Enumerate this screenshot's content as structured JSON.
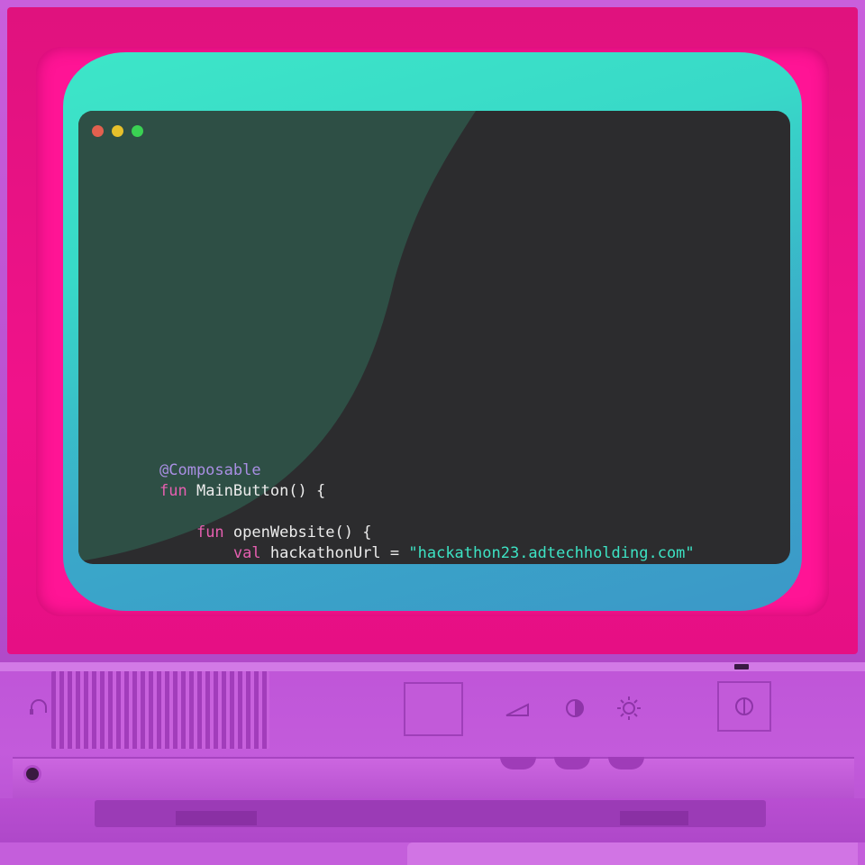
{
  "editor": {
    "window_controls": [
      "close",
      "minimize",
      "maximize"
    ],
    "colors": {
      "background": "#2c2c2e",
      "annotation": "#a98fe3",
      "keyword": "#e65fb0",
      "string": "#3de3c4",
      "text": "#ececec"
    },
    "code": {
      "line1_annotation": "@Composable",
      "line2_kw": "fun",
      "line2_rest": " MainButton() {",
      "line4_kw": "fun",
      "line4_rest": " openWebsite() {",
      "line5_kw": "val",
      "line5_mid": " hackathonUrl = ",
      "line5_str": "\"hackathon23.adtechholding.com\""
    }
  },
  "monitor": {
    "colors": {
      "bezel": "#f0128a",
      "body": "#bf55d8",
      "screen_top": "#3de6c8",
      "screen_bottom": "#3b98c8"
    },
    "icons": [
      "headphone-icon",
      "volume-icon",
      "contrast-icon",
      "brightness-icon",
      "power-icon"
    ]
  }
}
